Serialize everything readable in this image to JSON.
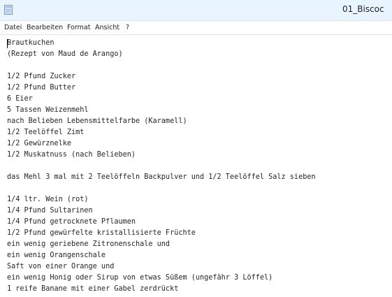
{
  "window": {
    "title": "01_Biscoc"
  },
  "menu": {
    "items": [
      "Datei",
      "Bearbeiten",
      "Format",
      "Ansicht",
      "?"
    ]
  },
  "document": {
    "lines": [
      "Brautkuchen",
      "(Rezept von Maud de Arango)",
      "",
      "1/2 Pfund Zucker",
      "1/2 Pfund Butter",
      "6 Eier",
      "5 Tassen Weizenmehl",
      "nach Belieben Lebensmittelfarbe (Karamell)",
      "1/2 Teelöffel Zimt",
      "1/2 Gewürznelke",
      "1/2 Muskatnuss (nach Belieben)",
      "",
      "das Mehl 3 mal mit 2 Teelöffeln Backpulver und 1/2 Teelöffel Salz sieben",
      "",
      "1/4 ltr. Wein (rot)",
      "1/4 Pfund Sultarinen",
      "1/4 Pfund getrocknete Pflaumen",
      "1/2 Pfund gewürfelte kristallisierte Früchte",
      "ein wenig geriebene Zitronenschale und",
      "ein wenig Orangenschale",
      "Saft von einer Orange und",
      "ein wenig Honig oder Sirup von etwas Süßem (ungefähr 3 Löffel)",
      "1 reife Banane mit einer Gabel zerdrückt"
    ]
  }
}
